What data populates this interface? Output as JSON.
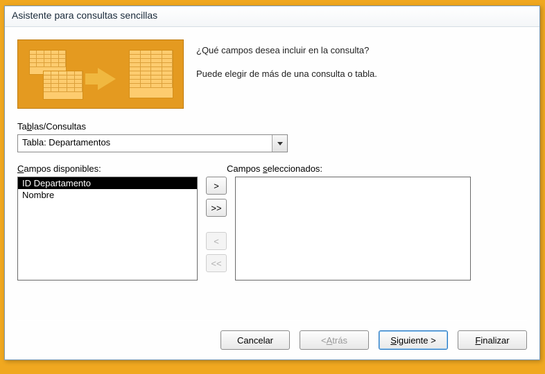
{
  "dialog": {
    "title": "Asistente para consultas sencillas",
    "intro_line1": "¿Qué campos desea incluir en la consulta?",
    "intro_line2": "Puede elegir de más de una consulta o tabla."
  },
  "tables_combo": {
    "label_prefix": "Ta",
    "label_underlined": "b",
    "label_suffix": "las/Consultas",
    "value": "Tabla: Departamentos"
  },
  "available": {
    "label_underlined": "C",
    "label_suffix": "ampos disponibles:",
    "items": [
      "ID Departamento",
      "Nombre"
    ],
    "selected_index": 0
  },
  "selected": {
    "label_prefix": "Campos ",
    "label_underlined": "s",
    "label_suffix": "eleccionados:",
    "items": []
  },
  "move_buttons": {
    "add": ">",
    "add_all": ">>",
    "remove": "<",
    "remove_all": "<<"
  },
  "footer": {
    "cancel": "Cancelar",
    "back_prefix": "< ",
    "back_underlined": "A",
    "back_suffix": "trás",
    "next_underlined": "S",
    "next_suffix": "iguiente >",
    "finish_underlined": "F",
    "finish_suffix": "inalizar"
  }
}
